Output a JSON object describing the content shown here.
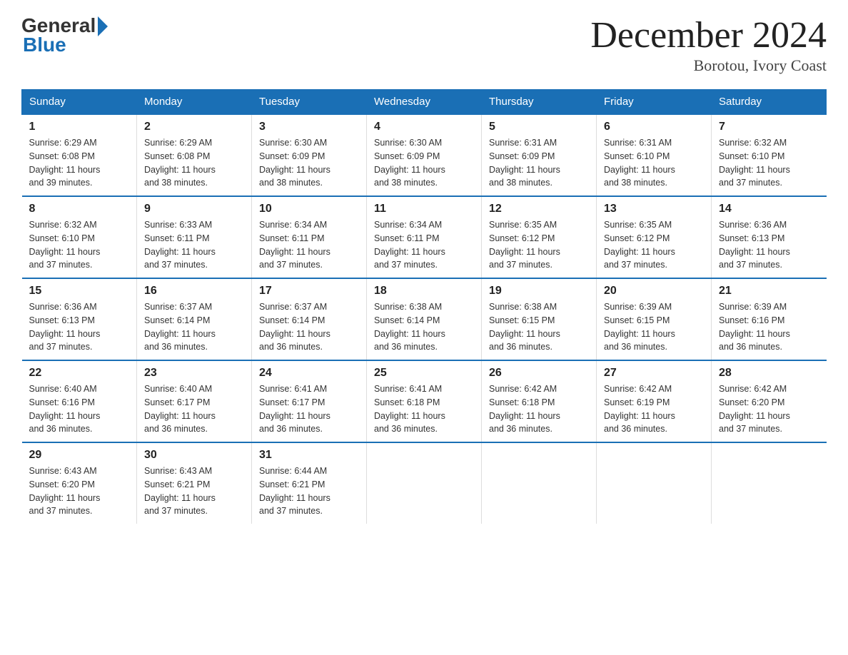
{
  "logo": {
    "general": "General",
    "blue": "Blue"
  },
  "title": {
    "month_year": "December 2024",
    "location": "Borotou, Ivory Coast"
  },
  "headers": [
    "Sunday",
    "Monday",
    "Tuesday",
    "Wednesday",
    "Thursday",
    "Friday",
    "Saturday"
  ],
  "weeks": [
    [
      {
        "day": "1",
        "sunrise": "6:29 AM",
        "sunset": "6:08 PM",
        "daylight": "11 hours and 39 minutes."
      },
      {
        "day": "2",
        "sunrise": "6:29 AM",
        "sunset": "6:08 PM",
        "daylight": "11 hours and 38 minutes."
      },
      {
        "day": "3",
        "sunrise": "6:30 AM",
        "sunset": "6:09 PM",
        "daylight": "11 hours and 38 minutes."
      },
      {
        "day": "4",
        "sunrise": "6:30 AM",
        "sunset": "6:09 PM",
        "daylight": "11 hours and 38 minutes."
      },
      {
        "day": "5",
        "sunrise": "6:31 AM",
        "sunset": "6:09 PM",
        "daylight": "11 hours and 38 minutes."
      },
      {
        "day": "6",
        "sunrise": "6:31 AM",
        "sunset": "6:10 PM",
        "daylight": "11 hours and 38 minutes."
      },
      {
        "day": "7",
        "sunrise": "6:32 AM",
        "sunset": "6:10 PM",
        "daylight": "11 hours and 37 minutes."
      }
    ],
    [
      {
        "day": "8",
        "sunrise": "6:32 AM",
        "sunset": "6:10 PM",
        "daylight": "11 hours and 37 minutes."
      },
      {
        "day": "9",
        "sunrise": "6:33 AM",
        "sunset": "6:11 PM",
        "daylight": "11 hours and 37 minutes."
      },
      {
        "day": "10",
        "sunrise": "6:34 AM",
        "sunset": "6:11 PM",
        "daylight": "11 hours and 37 minutes."
      },
      {
        "day": "11",
        "sunrise": "6:34 AM",
        "sunset": "6:11 PM",
        "daylight": "11 hours and 37 minutes."
      },
      {
        "day": "12",
        "sunrise": "6:35 AM",
        "sunset": "6:12 PM",
        "daylight": "11 hours and 37 minutes."
      },
      {
        "day": "13",
        "sunrise": "6:35 AM",
        "sunset": "6:12 PM",
        "daylight": "11 hours and 37 minutes."
      },
      {
        "day": "14",
        "sunrise": "6:36 AM",
        "sunset": "6:13 PM",
        "daylight": "11 hours and 37 minutes."
      }
    ],
    [
      {
        "day": "15",
        "sunrise": "6:36 AM",
        "sunset": "6:13 PM",
        "daylight": "11 hours and 37 minutes."
      },
      {
        "day": "16",
        "sunrise": "6:37 AM",
        "sunset": "6:14 PM",
        "daylight": "11 hours and 36 minutes."
      },
      {
        "day": "17",
        "sunrise": "6:37 AM",
        "sunset": "6:14 PM",
        "daylight": "11 hours and 36 minutes."
      },
      {
        "day": "18",
        "sunrise": "6:38 AM",
        "sunset": "6:14 PM",
        "daylight": "11 hours and 36 minutes."
      },
      {
        "day": "19",
        "sunrise": "6:38 AM",
        "sunset": "6:15 PM",
        "daylight": "11 hours and 36 minutes."
      },
      {
        "day": "20",
        "sunrise": "6:39 AM",
        "sunset": "6:15 PM",
        "daylight": "11 hours and 36 minutes."
      },
      {
        "day": "21",
        "sunrise": "6:39 AM",
        "sunset": "6:16 PM",
        "daylight": "11 hours and 36 minutes."
      }
    ],
    [
      {
        "day": "22",
        "sunrise": "6:40 AM",
        "sunset": "6:16 PM",
        "daylight": "11 hours and 36 minutes."
      },
      {
        "day": "23",
        "sunrise": "6:40 AM",
        "sunset": "6:17 PM",
        "daylight": "11 hours and 36 minutes."
      },
      {
        "day": "24",
        "sunrise": "6:41 AM",
        "sunset": "6:17 PM",
        "daylight": "11 hours and 36 minutes."
      },
      {
        "day": "25",
        "sunrise": "6:41 AM",
        "sunset": "6:18 PM",
        "daylight": "11 hours and 36 minutes."
      },
      {
        "day": "26",
        "sunrise": "6:42 AM",
        "sunset": "6:18 PM",
        "daylight": "11 hours and 36 minutes."
      },
      {
        "day": "27",
        "sunrise": "6:42 AM",
        "sunset": "6:19 PM",
        "daylight": "11 hours and 36 minutes."
      },
      {
        "day": "28",
        "sunrise": "6:42 AM",
        "sunset": "6:20 PM",
        "daylight": "11 hours and 37 minutes."
      }
    ],
    [
      {
        "day": "29",
        "sunrise": "6:43 AM",
        "sunset": "6:20 PM",
        "daylight": "11 hours and 37 minutes."
      },
      {
        "day": "30",
        "sunrise": "6:43 AM",
        "sunset": "6:21 PM",
        "daylight": "11 hours and 37 minutes."
      },
      {
        "day": "31",
        "sunrise": "6:44 AM",
        "sunset": "6:21 PM",
        "daylight": "11 hours and 37 minutes."
      },
      null,
      null,
      null,
      null
    ]
  ],
  "labels": {
    "sunrise": "Sunrise:",
    "sunset": "Sunset:",
    "daylight": "Daylight:"
  }
}
